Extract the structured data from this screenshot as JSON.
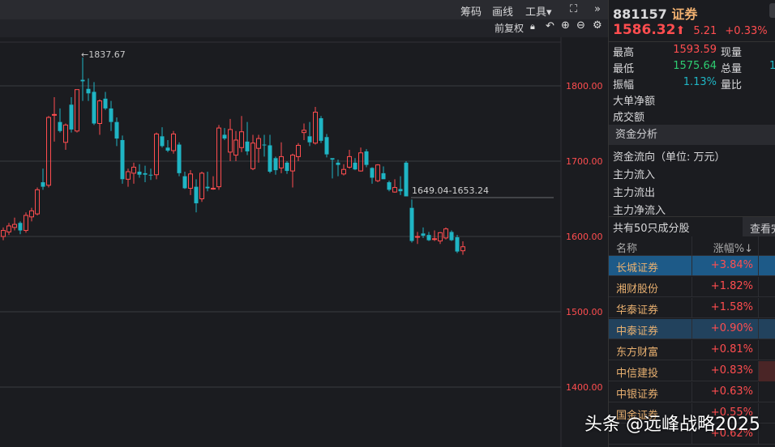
{
  "toolbar": {
    "chips": "筹码",
    "draw": "画线",
    "tools": "工具▾",
    "expand_icon": "⛶",
    "more_icon": "»"
  },
  "subbar": {
    "adjust": "前复权"
  },
  "chart_data": {
    "type": "candlestick",
    "yticks": [
      "1800.00",
      "1700.00",
      "1600.00",
      "1500.00",
      "1400.00"
    ],
    "ylim": [
      1390,
      1850
    ],
    "annotations": {
      "high": "←1837.67",
      "gap": "1649.04-1653.24"
    },
    "ohlc": [
      [
        1600,
        1612,
        1595,
        1608
      ],
      [
        1606,
        1618,
        1602,
        1614
      ],
      [
        1612,
        1625,
        1608,
        1616
      ],
      [
        1618,
        1620,
        1603,
        1608
      ],
      [
        1608,
        1632,
        1605,
        1628
      ],
      [
        1626,
        1638,
        1620,
        1634
      ],
      [
        1630,
        1665,
        1628,
        1662
      ],
      [
        1672,
        1690,
        1662,
        1666
      ],
      [
        1668,
        1760,
        1665,
        1758
      ],
      [
        1762,
        1785,
        1726,
        1762
      ],
      [
        1752,
        1770,
        1738,
        1740
      ],
      [
        1725,
        1750,
        1715,
        1748
      ],
      [
        1775,
        1785,
        1738,
        1742
      ],
      [
        1740,
        1795,
        1738,
        1795
      ],
      [
        1808,
        1837.67,
        1780,
        1806
      ],
      [
        1796,
        1810,
        1780,
        1790
      ],
      [
        1792,
        1805,
        1748,
        1750
      ],
      [
        1750,
        1782,
        1735,
        1780
      ],
      [
        1783,
        1792,
        1768,
        1770
      ],
      [
        1770,
        1780,
        1740,
        1752
      ],
      [
        1752,
        1758,
        1720,
        1730
      ],
      [
        1728,
        1734,
        1670,
        1676
      ],
      [
        1676,
        1690,
        1666,
        1686
      ],
      [
        1684,
        1698,
        1670,
        1692
      ],
      [
        1686,
        1696,
        1678,
        1682
      ],
      [
        1684,
        1694,
        1672,
        1682
      ],
      [
        1682,
        1690,
        1675,
        1681
      ],
      [
        1682,
        1738,
        1676,
        1736
      ],
      [
        1733,
        1745,
        1718,
        1720
      ],
      [
        1718,
        1728,
        1712,
        1714
      ],
      [
        1714,
        1740,
        1710,
        1736
      ],
      [
        1722,
        1725,
        1680,
        1684
      ],
      [
        1680,
        1686,
        1663,
        1664
      ],
      [
        1664,
        1688,
        1655,
        1683
      ],
      [
        1666,
        1676,
        1632,
        1644
      ],
      [
        1650,
        1686,
        1646,
        1684
      ],
      [
        1666,
        1686,
        1660,
        1664
      ],
      [
        1664,
        1680,
        1662,
        1664
      ],
      [
        1666,
        1748,
        1662,
        1744
      ],
      [
        1735,
        1744,
        1728,
        1730
      ],
      [
        1712,
        1756,
        1700,
        1742
      ],
      [
        1708,
        1740,
        1700,
        1728
      ],
      [
        1718,
        1760,
        1712,
        1739
      ],
      [
        1726,
        1752,
        1708,
        1713
      ],
      [
        1690,
        1735,
        1688,
        1724
      ],
      [
        1717,
        1735,
        1698,
        1730
      ],
      [
        1722,
        1735,
        1706,
        1721
      ],
      [
        1721,
        1735,
        1684,
        1686
      ],
      [
        1704,
        1706,
        1682,
        1688
      ],
      [
        1691,
        1725,
        1684,
        1706
      ],
      [
        1698,
        1700,
        1683,
        1687
      ],
      [
        1687,
        1710,
        1665,
        1708
      ],
      [
        1706,
        1724,
        1700,
        1721
      ],
      [
        1738,
        1750,
        1728,
        1741
      ],
      [
        1733,
        1752,
        1720,
        1725
      ],
      [
        1724,
        1772,
        1722,
        1765
      ],
      [
        1757,
        1760,
        1724,
        1727
      ],
      [
        1732,
        1736,
        1705,
        1709
      ],
      [
        1704,
        1704,
        1677,
        1702
      ],
      [
        1698,
        1702,
        1680,
        1695
      ],
      [
        1683,
        1696,
        1681,
        1689
      ],
      [
        1692,
        1715,
        1690,
        1706
      ],
      [
        1698,
        1704,
        1688,
        1689
      ],
      [
        1687,
        1718,
        1686,
        1711
      ],
      [
        1713,
        1716,
        1692,
        1695
      ],
      [
        1691,
        1692,
        1670,
        1678
      ],
      [
        1674,
        1696,
        1672,
        1695
      ],
      [
        1684,
        1693,
        1676,
        1676
      ],
      [
        1672,
        1674,
        1660,
        1662
      ],
      [
        1659,
        1676,
        1658,
        1665
      ],
      [
        1663,
        1680,
        1655,
        1660
      ],
      [
        1698,
        1700,
        1653.24,
        1653.24
      ],
      [
        1638,
        1649.04,
        1592,
        1594
      ],
      [
        1599,
        1606,
        1590,
        1600
      ],
      [
        1604,
        1612,
        1598,
        1601
      ],
      [
        1602,
        1606,
        1594,
        1595
      ],
      [
        1596,
        1608,
        1594,
        1597
      ],
      [
        1594,
        1606,
        1590,
        1605
      ],
      [
        1598,
        1612,
        1596,
        1610
      ],
      [
        1606,
        1608,
        1594,
        1595
      ],
      [
        1599,
        1602,
        1578,
        1580
      ],
      [
        1581,
        1593.59,
        1575.64,
        1586.32
      ]
    ]
  },
  "quote": {
    "code": "881157",
    "name": "证券",
    "price": "1586.32",
    "arrow": "⬆",
    "change": "5.21",
    "pct": "+0.33%"
  },
  "stats": [
    {
      "label": "最高",
      "value": "1593.59",
      "label2": "现量",
      "value2": ""
    },
    {
      "label": "最低",
      "value": "1575.64",
      "label2": "总量",
      "value2": "1"
    },
    {
      "label": "振幅",
      "value": "1.13%",
      "label2": "量比",
      "value2": ""
    },
    {
      "label": "大单净额"
    },
    {
      "label": "成交额"
    }
  ],
  "fund": {
    "title": "资金分析",
    "flow": "资金流向（单位: 万元）",
    "in": "主力流入",
    "out": "主力流出",
    "net": "主力净流入"
  },
  "constituents": {
    "count": "共有50只成分股",
    "view": "查看完"
  },
  "table": {
    "col_name": "名称",
    "col_pct": "涨幅%↓",
    "rows": [
      {
        "name": "长城证券",
        "pct": "+3.84%"
      },
      {
        "name": "湘财股份",
        "pct": "+1.82%"
      },
      {
        "name": "华泰证券",
        "pct": "+1.58%"
      },
      {
        "name": "中泰证券",
        "pct": "+0.90%"
      },
      {
        "name": "东方财富",
        "pct": "+0.81%"
      },
      {
        "name": "中信建投",
        "pct": "+0.83%"
      },
      {
        "name": "中银证券",
        "pct": "+0.63%"
      },
      {
        "name": "国金证券",
        "pct": "+0.55%"
      },
      {
        "name": "",
        "pct": "+0.62%"
      }
    ]
  },
  "watermark": "头条 @远峰战略2025",
  "colors": {
    "up": "#ff4d4f",
    "down": "#1fb5c4",
    "bg": "#1b1c20"
  }
}
